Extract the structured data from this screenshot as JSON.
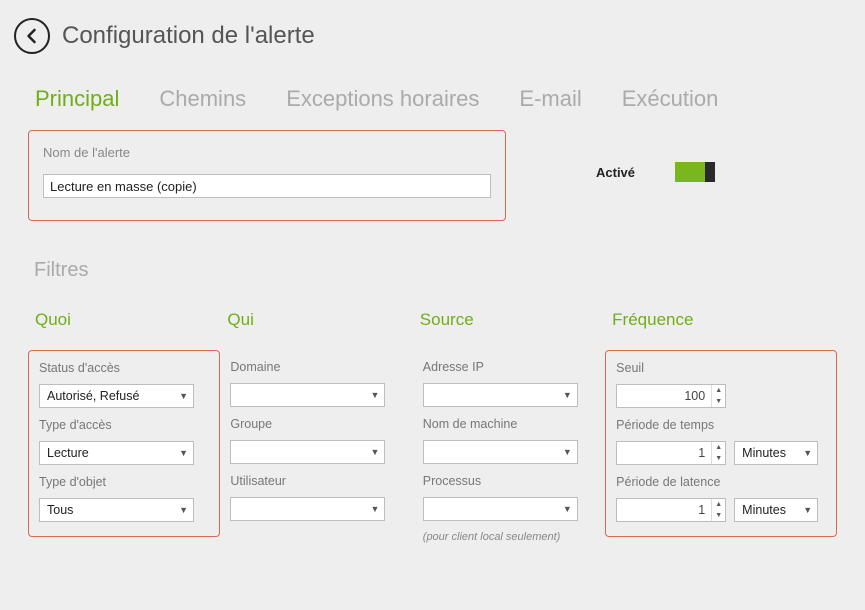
{
  "header": {
    "title": "Configuration de l'alerte"
  },
  "tabs": [
    {
      "label": "Principal",
      "active": true
    },
    {
      "label": "Chemins",
      "active": false
    },
    {
      "label": "Exceptions horaires",
      "active": false
    },
    {
      "label": "E-mail",
      "active": false
    },
    {
      "label": "Exécution",
      "active": false
    }
  ],
  "alert_name": {
    "label": "Nom de l'alerte",
    "value": "Lecture en masse (copie)"
  },
  "enabled": {
    "label": "Activé",
    "state": true
  },
  "filters_title": "Filtres",
  "columns": {
    "quoi": {
      "title": "Quoi",
      "highlighted": true,
      "fields": [
        {
          "label": "Status d'accès",
          "value": "Autorisé, Refusé"
        },
        {
          "label": "Type d'accès",
          "value": "Lecture"
        },
        {
          "label": "Type d'objet",
          "value": "Tous"
        }
      ]
    },
    "qui": {
      "title": "Qui",
      "highlighted": false,
      "fields": [
        {
          "label": "Domaine",
          "value": ""
        },
        {
          "label": "Groupe",
          "value": ""
        },
        {
          "label": "Utilisateur",
          "value": ""
        }
      ]
    },
    "source": {
      "title": "Source",
      "highlighted": false,
      "fields": [
        {
          "label": "Adresse IP",
          "value": ""
        },
        {
          "label": "Nom de machine",
          "value": ""
        },
        {
          "label": "Processus",
          "value": ""
        }
      ],
      "note": "(pour client local seulement)"
    },
    "frequence": {
      "title": "Fréquence",
      "highlighted": true,
      "fields": [
        {
          "label": "Seuil",
          "value": "100",
          "type": "spin"
        },
        {
          "label": "Période de temps",
          "value": "1",
          "type": "spin_unit",
          "unit": "Minutes"
        },
        {
          "label": "Période de latence",
          "value": "1",
          "type": "spin_unit",
          "unit": "Minutes"
        }
      ]
    }
  }
}
